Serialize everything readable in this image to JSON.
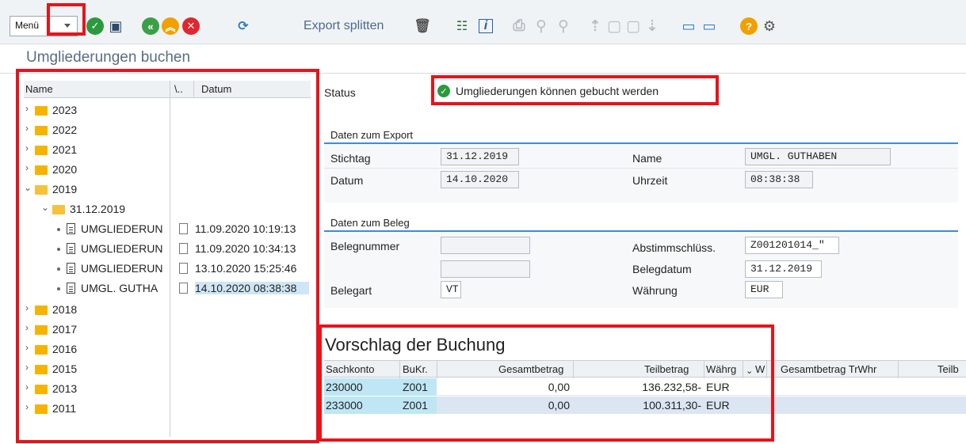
{
  "toolbar": {
    "menu_label": "Menü",
    "export_split_label": "Export splitten"
  },
  "page_title": "Umgliederungen buchen",
  "tree": {
    "headers": {
      "name": "Name",
      "col2": "\\..",
      "date": "Datum"
    },
    "years": [
      "2023",
      "2022",
      "2021",
      "2020",
      "2019",
      "2018",
      "2017",
      "2016",
      "2015",
      "2013",
      "2011"
    ],
    "expanded_year": "2019",
    "sub_folder": "31.12.2019",
    "docs": [
      {
        "name": "UMGLIEDERUN",
        "date": "11.09.2020 10:19:13"
      },
      {
        "name": "UMGLIEDERUN",
        "date": "11.09.2020 10:34:13"
      },
      {
        "name": "UMGLIEDERUN",
        "date": "13.10.2020 15:25:46"
      },
      {
        "name": "UMGL. GUTHA",
        "date": "14.10.2020 08:38:38"
      }
    ]
  },
  "status": {
    "label": "Status",
    "message": "Umgliederungen können gebucht werden"
  },
  "export_group": {
    "title": "Daten zum Export",
    "stichtag_label": "Stichtag",
    "stichtag_value": "31.12.2019",
    "datum_label": "Datum",
    "datum_value": "14.10.2020",
    "name_label": "Name",
    "name_value": "UMGL. GUTHABEN",
    "uhrzeit_label": "Uhrzeit",
    "uhrzeit_value": "08:38:38"
  },
  "beleg_group": {
    "title": "Daten zum Beleg",
    "belegnummer_label": "Belegnummer",
    "belegnummer_value": "",
    "belegnummer2_value": "",
    "belegart_label": "Belegart",
    "belegart_value": "VT",
    "abstimm_label": "Abstimmschlüss.",
    "abstimm_value": "Z001201014_\"",
    "belegdatum_label": "Belegdatum",
    "belegdatum_value": "31.12.2019",
    "waehrung_label": "Währung",
    "waehrung_value": "EUR"
  },
  "proposal": {
    "title": "Vorschlag der Buchung",
    "headers": [
      "Sachkonto",
      "BuKr.",
      "Gesamtbetrag",
      "Teilbetrag",
      "Währg",
      "W",
      "Gesamtbetrag TrWhr",
      "Teilb"
    ],
    "rows": [
      {
        "sachkonto": "230000",
        "bukr": "Z001",
        "gesamt": "0,00",
        "teil": "136.232,58-",
        "waehrg": "EUR"
      },
      {
        "sachkonto": "233000",
        "bukr": "Z001",
        "gesamt": "0,00",
        "teil": "100.311,30-",
        "waehrg": "EUR"
      }
    ]
  },
  "colors": {
    "accent": "#3a8ed6",
    "highlight": "#e8131a",
    "ok": "#2b9a3d"
  }
}
